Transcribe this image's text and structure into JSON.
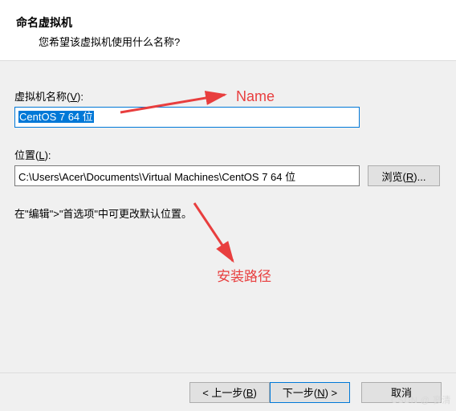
{
  "header": {
    "title": "命名虚拟机",
    "subtitle": "您希望该虚拟机使用什么名称?"
  },
  "name_field": {
    "label_prefix": "虚拟机名称(",
    "label_key": "V",
    "label_suffix": "):",
    "value": "CentOS 7 64 位"
  },
  "location_field": {
    "label_prefix": "位置(",
    "label_key": "L",
    "label_suffix": "):",
    "value": "C:\\Users\\Acer\\Documents\\Virtual Machines\\CentOS 7 64 位",
    "browse_prefix": "浏览(",
    "browse_key": "R",
    "browse_suffix": ")..."
  },
  "hint": "在\"编辑\">\"首选项\"中可更改默认位置。",
  "annotations": {
    "name": "Name",
    "install_path": "安装路径"
  },
  "footer": {
    "back_prefix": "< 上一步(",
    "back_key": "B",
    "back_suffix": ")",
    "next_prefix": "下一步(",
    "next_key": "N",
    "next_suffix": ") >",
    "cancel": "取消"
  },
  "watermark": "CSDN @ 寥清"
}
